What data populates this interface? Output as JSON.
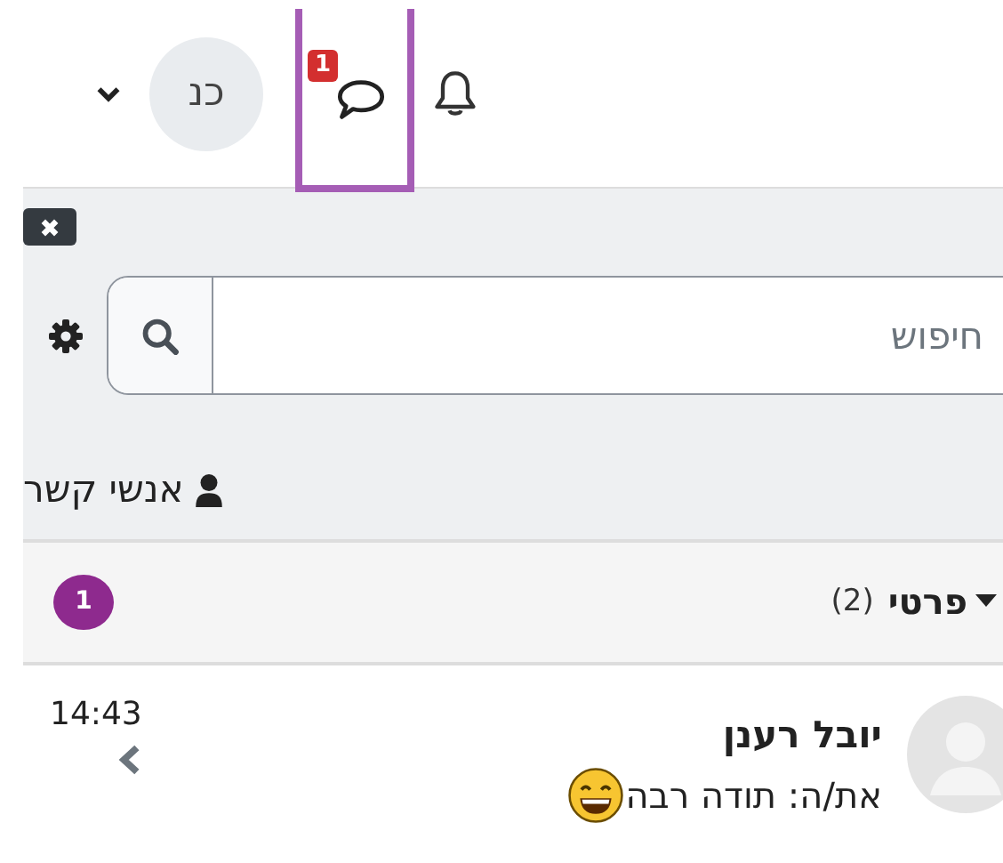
{
  "header": {
    "user_initials": "כנ",
    "messages_badge": "1",
    "messages_selected": true
  },
  "drawer": {
    "search": {
      "placeholder": "חיפוש"
    },
    "contacts_link": "אנשי קשר",
    "sections": [
      {
        "title": "פרטי",
        "count": "(2)",
        "expanded": true,
        "unread_badge": "1",
        "conversations": [
          {
            "name": "יובל רענן",
            "time": "14:43",
            "preview": "את/ה: תודה רבה"
          }
        ]
      }
    ]
  }
}
